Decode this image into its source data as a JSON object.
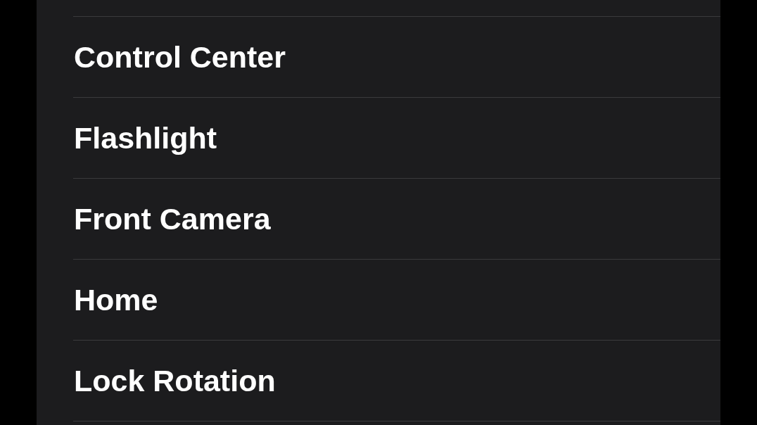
{
  "settings_list": {
    "items": [
      {
        "label": "Control Center"
      },
      {
        "label": "Flashlight"
      },
      {
        "label": "Front Camera"
      },
      {
        "label": "Home"
      },
      {
        "label": "Lock Rotation"
      }
    ]
  }
}
